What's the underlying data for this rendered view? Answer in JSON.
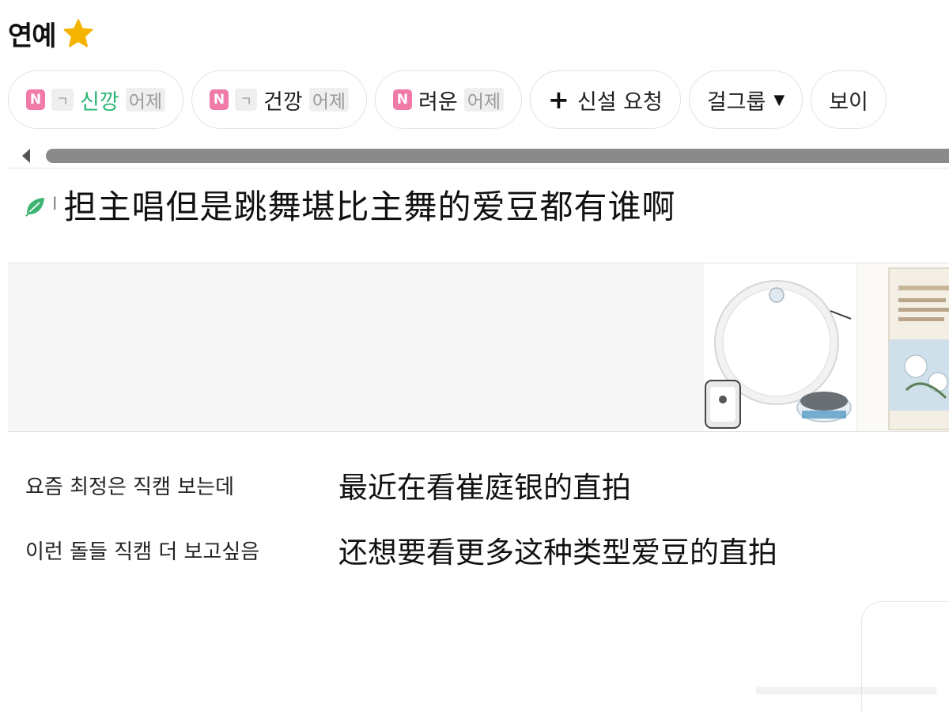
{
  "header": {
    "title": "연예",
    "star_icon": "star-icon",
    "star_color": "#f5b400"
  },
  "chips": [
    {
      "badge": "N",
      "prefix": "ㄱ",
      "name": "신깡",
      "time": "어제",
      "name_color": "#2bb673"
    },
    {
      "badge": "N",
      "prefix": "ㄱ",
      "name": "건깡",
      "time": "어제"
    },
    {
      "badge": "N",
      "name": "려운",
      "time": "어제"
    },
    {
      "icon": "plus-icon",
      "label": "신설 요청"
    },
    {
      "label": "걸그룹",
      "icon": "caret-down-icon"
    },
    {
      "label": "보이"
    }
  ],
  "colors": {
    "badge_pink": "#f07aa8",
    "accent_green": "#2bb673",
    "scroll_thumb": "#8a8a8a",
    "ad_background": "#f6f6f6"
  },
  "post": {
    "title_icon": "leaf-icon",
    "title_mark": "I",
    "title": "担主唱但是跳舞堪比主舞的爱豆都有谁啊"
  },
  "body": {
    "lines": [
      {
        "korean": "요즘 최정은 직캠 보는데",
        "chinese": "最近在看崔庭银的直拍"
      },
      {
        "korean": "이런 돌들 직캠 더 보고싶음",
        "chinese": "还想要看更多这种类型爱豆的直拍"
      }
    ]
  }
}
